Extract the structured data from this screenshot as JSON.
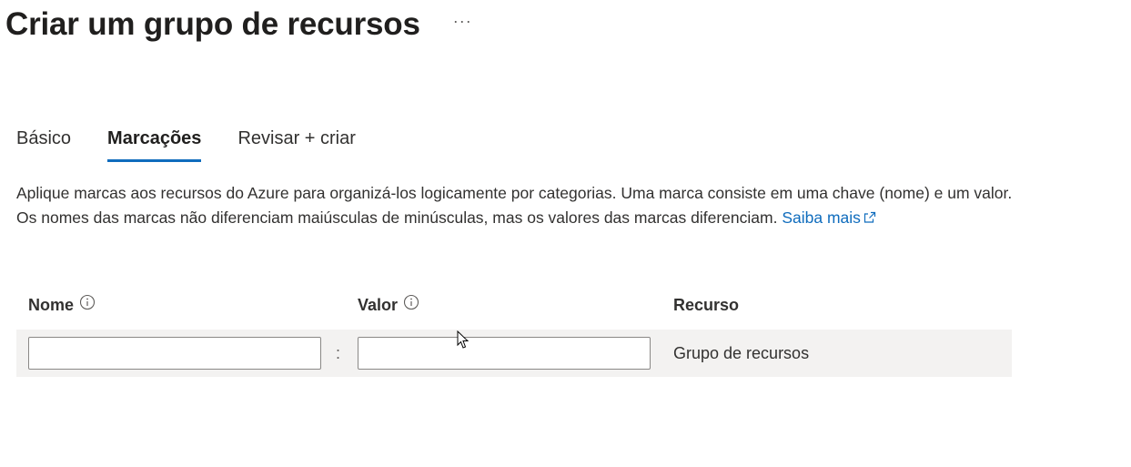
{
  "header": {
    "title": "Criar um grupo de recursos",
    "more_label": "···"
  },
  "tabs": [
    {
      "label": "Básico",
      "active": false
    },
    {
      "label": "Marcações",
      "active": true
    },
    {
      "label": "Revisar + criar",
      "active": false
    }
  ],
  "description": {
    "text": "Aplique marcas aos recursos do Azure para organizá-los logicamente por categorias. Uma marca consiste em uma chave (nome) e um valor. Os nomes das marcas não diferenciam maiúsculas de minúsculas, mas os valores das marcas diferenciam. ",
    "link_label": "Saiba mais",
    "link_icon": "external-link-icon"
  },
  "table": {
    "columns": [
      {
        "label": "Nome",
        "info_icon": "info-icon"
      },
      {
        "label": "Valor",
        "info_icon": "info-icon"
      },
      {
        "label": "Recurso"
      }
    ],
    "rows": [
      {
        "name_value": "",
        "value_value": "",
        "separator": ":",
        "resource": "Grupo de recursos"
      }
    ]
  },
  "colors": {
    "accent": "#0f6cbd",
    "row_background": "#f3f2f1",
    "input_border": "#8a8886"
  }
}
